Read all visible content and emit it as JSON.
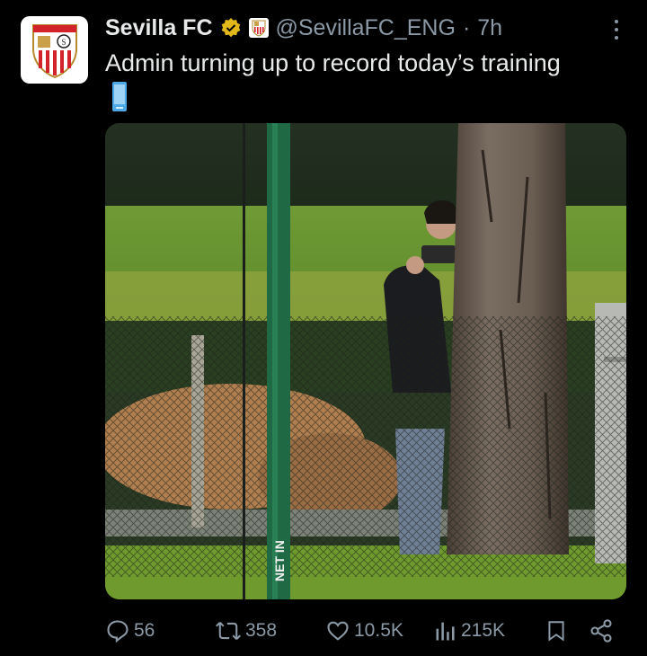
{
  "tweet": {
    "display_name": "Sevilla FC",
    "handle": "@SevillaFC_ENG",
    "separator": "·",
    "time": "7h",
    "text": "Admin turning up to record today’s training",
    "emoji": "mobile-phone-icon",
    "media": {
      "description_icon": "photo",
      "net_text": "NET IN"
    }
  },
  "actions": {
    "replies": "56",
    "reposts": "358",
    "likes": "10.5K",
    "views": "215K"
  },
  "colors": {
    "background": "#000000",
    "text": "#e7e9ea",
    "muted": "#8b98a5",
    "verified": "#e2b719",
    "crest_red": "#d2232a"
  }
}
